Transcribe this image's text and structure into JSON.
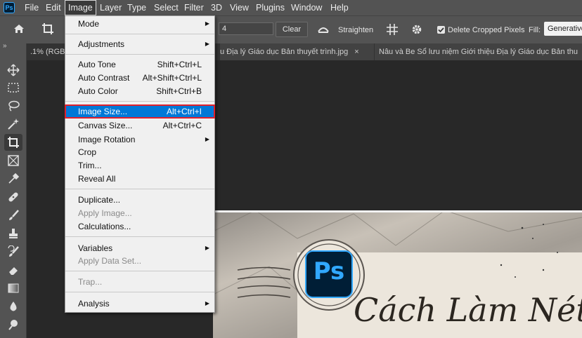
{
  "menubar": {
    "logo": "Ps",
    "items": [
      "File",
      "Edit",
      "Image",
      "Layer",
      "Type",
      "Select",
      "Filter",
      "3D",
      "View",
      "Plugins",
      "Window",
      "Help"
    ]
  },
  "options": {
    "value": "4",
    "clear": "Clear",
    "straighten": "Straighten",
    "delete_cropped": "Delete Cropped Pixels",
    "fill_label": "Fill:",
    "fill_value": "Generative"
  },
  "tabs": [
    ".1% (RGB",
    "u Địa lý Giáo dục Bản thuyết trình.jpg",
    "Nâu và Be Sổ lưu niệm Giới thiệu Địa lý Giáo dục Bản thu"
  ],
  "tab_close": "×",
  "menu": {
    "items": [
      {
        "label": "Mode",
        "submenu": true
      },
      {
        "label": "Adjustments",
        "submenu": true
      },
      {
        "label": "Auto Tone",
        "shortcut": "Shift+Ctrl+L"
      },
      {
        "label": "Auto Contrast",
        "shortcut": "Alt+Shift+Ctrl+L"
      },
      {
        "label": "Auto Color",
        "shortcut": "Shift+Ctrl+B"
      },
      {
        "label": "Image Size...",
        "shortcut": "Alt+Ctrl+I",
        "highlighted": true
      },
      {
        "label": "Canvas Size...",
        "shortcut": "Alt+Ctrl+C"
      },
      {
        "label": "Image Rotation",
        "submenu": true
      },
      {
        "label": "Crop"
      },
      {
        "label": "Trim..."
      },
      {
        "label": "Reveal All"
      },
      {
        "label": "Duplicate..."
      },
      {
        "label": "Apply Image...",
        "disabled": true
      },
      {
        "label": "Calculations..."
      },
      {
        "label": "Variables",
        "submenu": true
      },
      {
        "label": "Apply Data Set...",
        "disabled": true
      },
      {
        "label": "Trap...",
        "disabled": true
      },
      {
        "label": "Analysis",
        "submenu": true
      }
    ],
    "submenu_arrow": "▶"
  },
  "canvas": {
    "ps_badge": "Ps",
    "title_text": "Cách Làm Nét"
  },
  "colors": {
    "menu_highlight": "#0078d7",
    "highlight_outline": "#e0202c",
    "ps_blue": "#31a8ff",
    "ps_dark": "#001e36"
  },
  "icons": [
    "home-icon",
    "crop-icon",
    "straighten-icon",
    "grid-icon",
    "gear-icon",
    "checkbox-icon",
    "move-icon",
    "marquee-icon",
    "lasso-icon",
    "magic-wand-icon",
    "frame-icon",
    "eyedropper-icon",
    "healing-icon",
    "brush-icon",
    "stamp-icon",
    "history-brush-icon",
    "eraser-icon",
    "gradient-icon",
    "blur-icon",
    "dodge-icon"
  ]
}
